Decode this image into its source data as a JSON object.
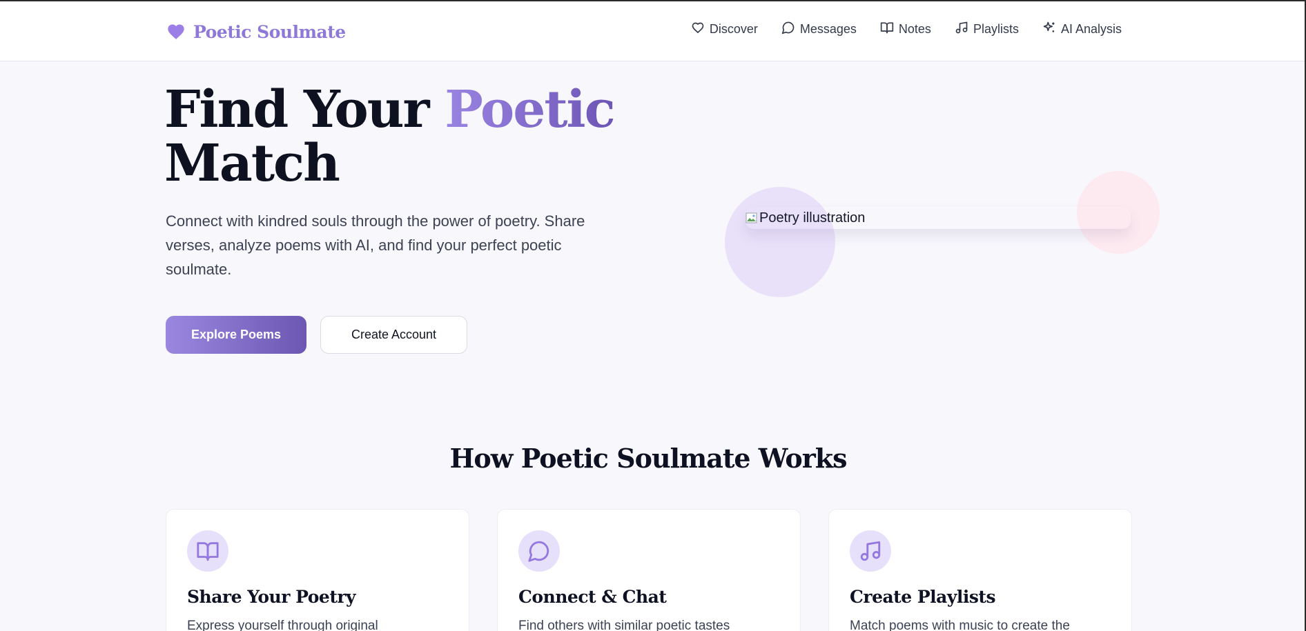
{
  "brand": {
    "name": "Poetic Soulmate",
    "icon": "heart-icon"
  },
  "nav": {
    "items": [
      {
        "label": "Discover",
        "icon": "heart-outline-icon"
      },
      {
        "label": "Messages",
        "icon": "chat-bubble-icon"
      },
      {
        "label": "Notes",
        "icon": "book-open-icon"
      },
      {
        "label": "Playlists",
        "icon": "music-note-icon"
      },
      {
        "label": "AI Analysis",
        "icon": "sparkles-icon"
      }
    ]
  },
  "hero": {
    "title_part1": "Find Your ",
    "title_accent": "Poetic",
    "title_part2": "Match",
    "description": "Connect with kindred souls through the power of poetry. Share verses, analyze poems with AI, and find your perfect poetic soulmate.",
    "primary_button": "Explore Poems",
    "secondary_button": "Create Account",
    "illustration_alt": "Poetry illustration"
  },
  "how_it_works": {
    "title": "How Poetic Soulmate Works",
    "cards": [
      {
        "title": "Share Your Poetry",
        "description": "Express yourself through original",
        "icon": "book-open-icon"
      },
      {
        "title": "Connect & Chat",
        "description": "Find others with similar poetic tastes",
        "icon": "chat-bubble-icon"
      },
      {
        "title": "Create Playlists",
        "description": "Match poems with music to create the",
        "icon": "music-note-icon"
      }
    ]
  },
  "colors": {
    "accent": "#8f79d8",
    "accent_dark": "#6c58b2",
    "background": "#f8f7fc",
    "icon_bg": "#e7e0fb",
    "circle_pink": "#fdeaf0"
  }
}
